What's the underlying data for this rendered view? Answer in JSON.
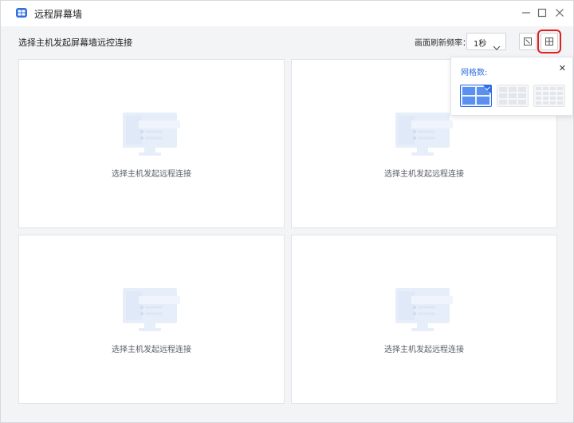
{
  "window": {
    "title": "远程屏幕墙",
    "controls": [
      "minimize-icon",
      "maximize-icon",
      "close-icon"
    ]
  },
  "toolbar": {
    "hint": "选择主机发起屏幕墙远控连接",
    "refresh_label": "画面刷新频率：",
    "refresh_value": "1秒",
    "buttons": [
      "fullscreen-icon",
      "grid-layout-icon"
    ]
  },
  "grid_popover": {
    "title": "网格数:",
    "options": [
      "2x2",
      "3x3",
      "4x4"
    ],
    "selected_option": "2x2"
  },
  "cells": [
    {
      "text": "选择主机发起远程连接"
    },
    {
      "text": "选择主机发起远程连接"
    },
    {
      "text": "选择主机发起远程连接"
    },
    {
      "text": "选择主机发起远程连接"
    }
  ],
  "colors": {
    "accent": "#2f6fe0",
    "highlight_outline": "#e02020"
  }
}
